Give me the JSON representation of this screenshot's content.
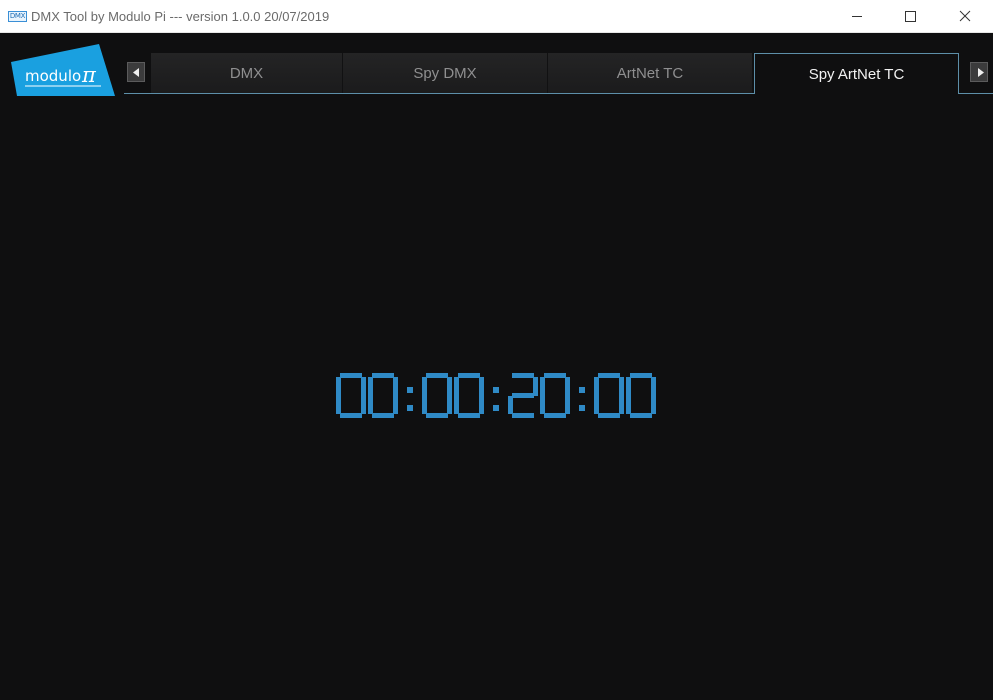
{
  "window": {
    "title": "DMX Tool by Modulo Pi --- version 1.0.0 20/07/2019",
    "icon_text": "DMX",
    "controls": {
      "minimize_icon": "minimize-icon",
      "maximize_icon": "maximize-icon",
      "close_icon": "close-icon"
    }
  },
  "logo": {
    "text": "modulo",
    "symbol": "π",
    "background_color": "#1aa0e0"
  },
  "tabs": [
    {
      "label": "DMX",
      "active": false
    },
    {
      "label": "Spy DMX",
      "active": false
    },
    {
      "label": "ArtNet TC",
      "active": false
    },
    {
      "label": "Spy ArtNet TC",
      "active": true
    }
  ],
  "tab_scroll": {
    "left_icon": "triangle-left-icon",
    "right_icon": "triangle-right-icon"
  },
  "timecode": {
    "hours": "00",
    "minutes": "00",
    "seconds": "20",
    "frames": "00",
    "color": "#2f8ac6"
  },
  "colors": {
    "background": "#0f0f10",
    "tab_active_border": "#5d8fa9",
    "tab_inactive_text": "#8f8f90",
    "tab_active_text": "#f2f2f2"
  }
}
